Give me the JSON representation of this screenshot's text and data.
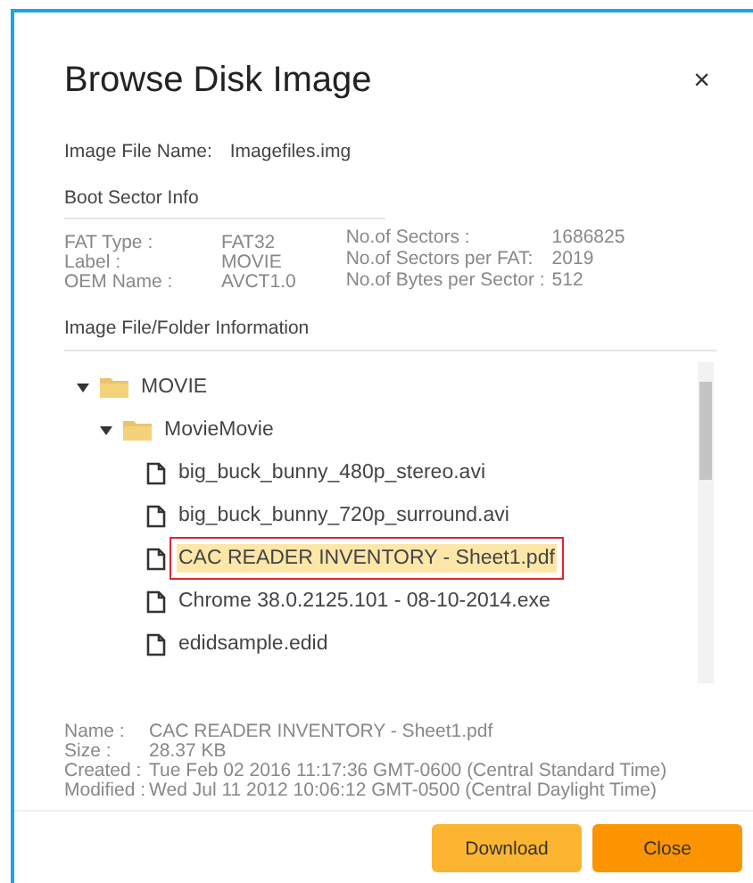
{
  "dialog": {
    "title": "Browse Disk Image",
    "close": "×"
  },
  "image_file": {
    "label": "Image File Name:",
    "value": "Imagefiles.img"
  },
  "boot_sector": {
    "heading": "Boot Sector Info",
    "left": [
      {
        "label": "FAT Type :",
        "value": "FAT32"
      },
      {
        "label": "Label :",
        "value": "MOVIE"
      },
      {
        "label": "OEM Name :",
        "value": "AVCT1.0"
      }
    ],
    "right": [
      {
        "label": "No.of Sectors :",
        "value": "1686825"
      },
      {
        "label": "No.of Sectors per FAT:",
        "value": "2019"
      },
      {
        "label": "No.of Bytes per Sector :",
        "value": "512"
      }
    ]
  },
  "tree": {
    "heading": "Image File/Folder Information",
    "items": [
      {
        "kind": "folder",
        "name": "MOVIE",
        "expanded": true,
        "selected": false,
        "children": [
          {
            "kind": "folder",
            "name": "MovieMovie",
            "expanded": true,
            "selected": false,
            "children": [
              {
                "kind": "file",
                "name": "big_buck_bunny_480p_stereo.avi",
                "selected": false
              },
              {
                "kind": "file",
                "name": "big_buck_bunny_720p_surround.avi",
                "selected": false
              },
              {
                "kind": "file",
                "name": "CAC READER INVENTORY - Sheet1.pdf",
                "selected": true
              },
              {
                "kind": "file",
                "name": "Chrome 38.0.2125.101 - 08-10-2014.exe",
                "selected": false
              },
              {
                "kind": "file",
                "name": "edidsample.edid",
                "selected": false
              }
            ]
          }
        ]
      }
    ]
  },
  "details": [
    {
      "label": "Name :",
      "value": "CAC READER INVENTORY - Sheet1.pdf"
    },
    {
      "label": "Size :",
      "value": "28.37 KB"
    },
    {
      "label": "Created :",
      "value": "Tue Feb 02 2016 11:17:36 GMT-0600 (Central Standard Time)"
    },
    {
      "label": "Modified :",
      "value": "Wed Jul 11 2012 10:06:12 GMT-0500 (Central Daylight Time)"
    }
  ],
  "buttons": [
    {
      "kind": "secondary",
      "label": "Download"
    },
    {
      "kind": "primary",
      "label": "Close"
    }
  ]
}
